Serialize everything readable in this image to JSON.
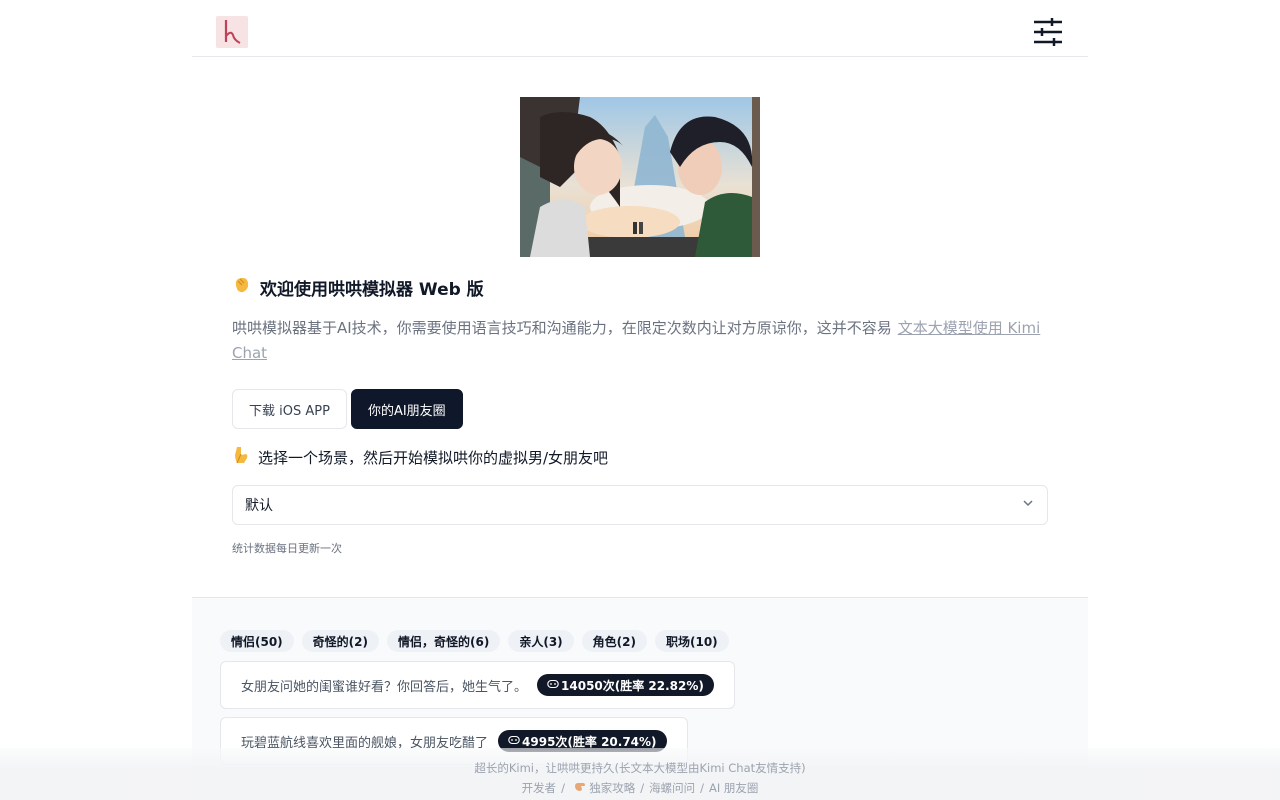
{
  "welcome": {
    "title": "欢迎使用哄哄模拟器 Web 版",
    "description": "哄哄模拟器基于AI技术，你需要使用语言技巧和沟通能力，在限定次数内让对方原谅你，这并不容易",
    "link": "文本大模型使用 Kimi Chat"
  },
  "buttons": {
    "download": "下载 iOS APP",
    "moments": "你的AI朋友圈"
  },
  "choose_prompt": "选择一个场景，然后开始模拟哄你的虚拟男/女朋友吧",
  "select": {
    "value": "默认"
  },
  "stats_note": "统计数据每日更新一次",
  "categories": [
    "情侣(50)",
    "奇怪的(2)",
    "情侣，奇怪的(6)",
    "亲人(3)",
    "角色(2)",
    "职场(10)"
  ],
  "scenes": [
    {
      "text": "女朋友问她的闺蜜谁好看？你回答后，她生气了。",
      "badge": "14050次(胜率 22.82%)"
    },
    {
      "text": "玩碧蓝航线喜欢里面的舰娘，女朋友吃醋了",
      "badge": "4995次(胜率 20.74%)"
    }
  ],
  "footer": {
    "line1": "超长的Kimi，让哄哄更持久(长文本大模型由Kimi Chat友情支持)",
    "developer": "开发者",
    "guide": "独家攻略",
    "question": "海螺问问",
    "moments": "AI 朋友圈"
  },
  "colors": {
    "primary": "#0f172a",
    "muted": "#6b7280",
    "border": "#e5e7eb"
  }
}
